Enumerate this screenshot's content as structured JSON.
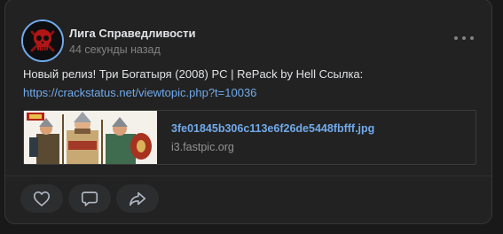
{
  "post": {
    "author": "Лига Справедливости",
    "time": "44 секунды назад",
    "text": "Новый релиз! Три Богатыря (2008) PC | RePack by Hell Ссылка:",
    "link": "https://crackstatus.net/viewtopic.php?t=10036",
    "attachment": {
      "filename": "3fe01845b306c113e6f26de5448fbfff.jpg",
      "domain": "i3.fastpic.org"
    }
  },
  "icons": {
    "avatar": "red-skull-icon",
    "more": "more-dots-icon",
    "like": "heart-icon",
    "comment": "comment-icon",
    "share": "share-icon"
  },
  "colors": {
    "background": "#191919",
    "card": "#222222",
    "text": "#e1e3e6",
    "secondary": "#828282",
    "accent": "#71aaeb"
  }
}
